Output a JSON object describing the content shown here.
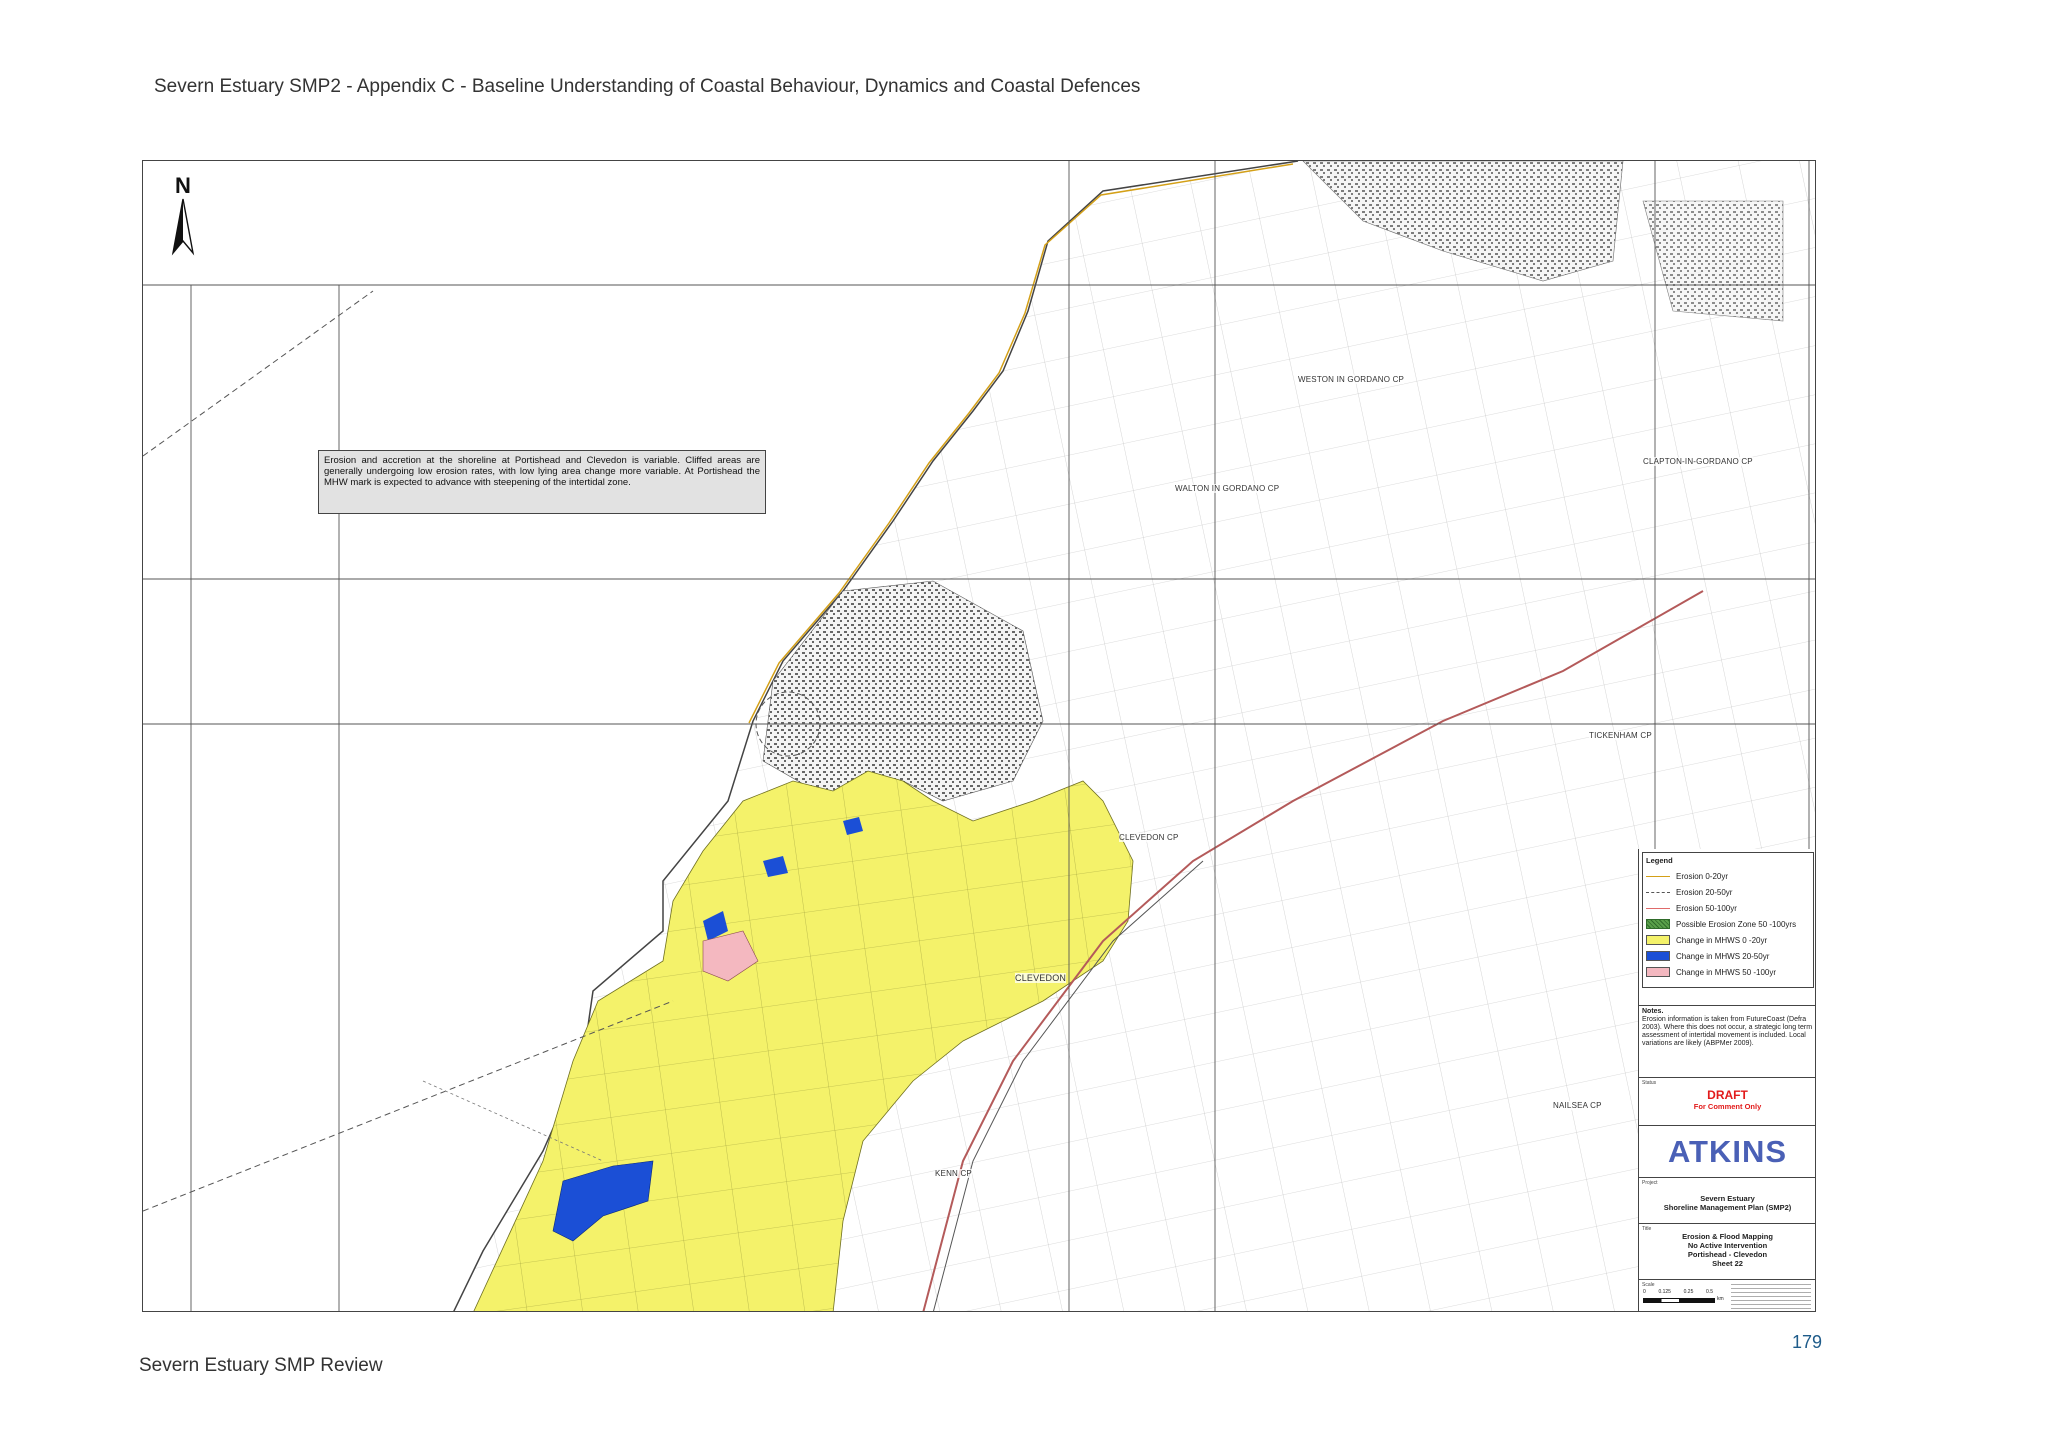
{
  "header": "Severn Estuary SMP2 - Appendix C - Baseline Understanding of Coastal Behaviour, Dynamics and Coastal Defences",
  "footer": "Severn Estuary SMP Review",
  "page_number": "179",
  "map": {
    "north_label": "N",
    "info_box": "Erosion and accretion at the shoreline at Portishead and Clevedon is variable. Cliffed areas are generally undergoing low erosion rates, with low lying area change more variable. At Portishead the MHW mark is expected to advance with steepening of the intertidal zone.",
    "places": {
      "weston": "WESTON IN GORDANO CP",
      "walton": "WALTON IN GORDANO CP",
      "clapton": "CLAPTON-IN-GORDANO CP",
      "tickenham": "TICKENHAM CP",
      "clevedon_cp": "CLEVEDON CP",
      "clevedon": "CLEVEDON",
      "nailsea": "NAILSEA CP",
      "kenn": "KENN CP"
    },
    "colors": {
      "yellow": "#f4f26a",
      "blue": "#1b4fd6",
      "pink": "#f4b8c0",
      "green": "#5aa04a"
    }
  },
  "legend": {
    "title": "Legend",
    "items": [
      {
        "label": "Erosion 0-20yr",
        "kind": "line",
        "color": "#d4a017",
        "style": "solid"
      },
      {
        "label": "Erosion 20-50yr",
        "kind": "line",
        "color": "#555555",
        "style": "dashed"
      },
      {
        "label": "Erosion 50-100yr",
        "kind": "line",
        "color": "#e06a6a",
        "style": "solid"
      },
      {
        "label": "Possible Erosion Zone 50 -100yrs",
        "kind": "swatch",
        "color": "#5aa04a",
        "pattern": true
      },
      {
        "label": "Change in MHWS 0 -20yr",
        "kind": "swatch",
        "color": "#f4f26a"
      },
      {
        "label": "Change in MHWS 20-50yr",
        "kind": "swatch",
        "color": "#1b4fd6"
      },
      {
        "label": "Change in MHWS 50 -100yr",
        "kind": "swatch",
        "color": "#f4b8c0"
      }
    ]
  },
  "notes": {
    "title": "Notes.",
    "text": "Erosion information is taken from FutureCoast (Defra 2003). Where this does not occur, a strategic long term assessment of intertidal movement is included. Local variations are likely (ABPMer 2009)."
  },
  "status": {
    "label": "Status",
    "draft": "DRAFT",
    "comment": "For Comment Only"
  },
  "logo": "ATKINS",
  "project": {
    "label": "Project",
    "line1": "Severn Estuary",
    "line2": "Shoreline Management Plan (SMP2)"
  },
  "title_block": {
    "label": "Title",
    "line1": "Erosion & Flood Mapping",
    "line2": "No Active Intervention",
    "line3": "Portishead - Clevedon",
    "line4": "Sheet 22"
  },
  "scale": {
    "label": "Scale",
    "ticks": [
      "0",
      "0.125",
      "0.25",
      "0.5"
    ],
    "unit": "km"
  }
}
